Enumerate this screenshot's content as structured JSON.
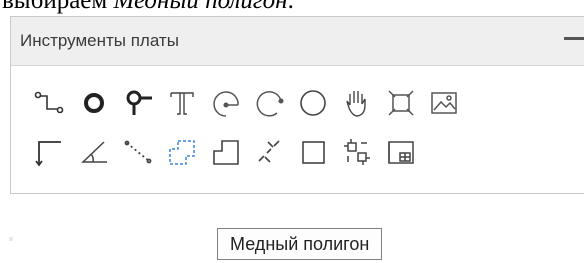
{
  "document": {
    "prefix": "выбираем ",
    "emphasis": "Медный полигон",
    "suffix": "."
  },
  "panel": {
    "title": "Инструменты платы",
    "collapse_symbol": "—"
  },
  "tools": {
    "row1": [
      "route-trace-icon",
      "via-icon",
      "pad-icon",
      "text-icon",
      "arc-center-icon",
      "arc-edge-icon",
      "circle-icon",
      "pan-hand-icon",
      "component-icon",
      "image-icon"
    ],
    "row2": [
      "dimension-icon",
      "angle-icon",
      "measure-distance-icon",
      "copper-polygon-icon",
      "polygon-line-icon",
      "jumper-icon",
      "rectangle-icon",
      "group-icon",
      "panel-array-icon"
    ]
  },
  "tooltip": {
    "text": "Медный полигон"
  }
}
